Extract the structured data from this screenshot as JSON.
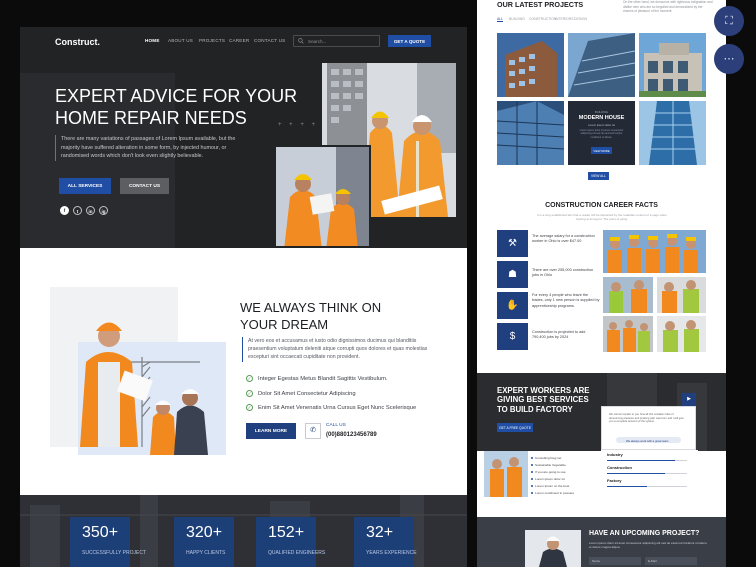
{
  "left": {
    "logo": "Construct.",
    "nav": [
      "HOME",
      "ABOUT US",
      "PROJECTS",
      "CAREER",
      "CONTACT US"
    ],
    "search_placeholder": "Search...",
    "quote_button": "GET A QUOTE",
    "hero_title": "EXPERT ADVICE FOR YOUR HOME REPAIR NEEDS",
    "hero_text": "There are many variations of passages of Lorem Ipsum available, but the majority have suffered alteration in some form, by injected humour, or randomised words which don't look even slightly believable.",
    "hero_buttons": [
      "ALL SERVICES",
      "CONTACT US"
    ],
    "social": [
      "f",
      "t",
      "in",
      "ig"
    ],
    "dream_title": "WE ALWAYS THINK ON YOUR DREAM",
    "dream_text": "At vero eos et accusamus et iusto odio dignissimos ducimus qui blanditiis praesentium voluptatum deleniti atque corrupti quos dolores et quas molestias excepturi sint occaecati cupiditate non provident.",
    "checks": [
      "Integer Egestas Metus Blandit Sagittis Vestibulum.",
      "Dolor Sit Amet Consectetur Adipiscing",
      "Enim Sit Amet Venenatis Urna Cursus Eget Nunc Scelerisque"
    ],
    "learn_more": "LEARN MORE",
    "call_label": "CALL US",
    "phone": "(00)880123456789",
    "stats": [
      {
        "value": "350+",
        "label": "SUCCESSFULLY PROJECT"
      },
      {
        "value": "320+",
        "label": "HAPPY CLIENTS"
      },
      {
        "value": "152+",
        "label": "QUALIFIED ENGINEERS"
      },
      {
        "value": "32+",
        "label": "YEARS EXPERIENCE"
      }
    ]
  },
  "right": {
    "projects_title": "OUR LATEST PROJECTS",
    "projects_sub": "On the other hand, we denounce with righteous indignation and dislike men who are so beguiled and demoralized by the charms of pleasure of the moment.",
    "filters": [
      "ALL",
      "BUILDING",
      "CONSTRUCTION",
      "INTERIORS",
      "DESIGN"
    ],
    "featured_label": "BUILDING",
    "featured_title": "MODERN HOUSE",
    "featured_sub": "Lorem ipsum dolor sit",
    "featured_text": "Lorem ipsum dolor sit amet consectetur adipiscing elit sed do eiusmod tempor incididunt ut labore.",
    "view_more": "VIEW MORE",
    "view_all": "VIEW ALL",
    "facts_title": "CONSTRUCTION CAREER FACTS",
    "facts_sub": "It is a long established fact that a reader will be distracted by the readable content of a page when looking at its layout. The point of using.",
    "facts": [
      "The average salary for a construction worker in Ohio is over $47.00",
      "There are over 255,000 construction jobs in Ohio",
      "For every 4 people who leave the trades, only 1 new person is supplied by apprenticeship programs.",
      "Construction is projected to add 790,400 jobs by 2024"
    ],
    "workers_title": "EXPERT WORKERS ARE GIVING BEST SERVICES TO BUILD FACTORY",
    "workers_button": "GET A FREE QUOTE",
    "workers_card_text": "We cannot explain to you how all this mistaken idea of denouncing pleasure and praising pain was born and I will give you a complete account of the system.",
    "workers_pill": "We always work with a great team",
    "workers_list": [
      "Consulting blog set",
      "Sustainable Vegetable",
      "If you are going to use",
      "Lorem ipsum dolor sit",
      "Lorem Ipsum on the best",
      "Lorem condiment in posuere"
    ],
    "bars": [
      {
        "label": "Industry",
        "value": 0.85
      },
      {
        "label": "Construction",
        "value": 0.72
      },
      {
        "label": "Factory",
        "value": 0.5
      }
    ],
    "upcoming_title": "HAVE AN UPCOMING PROJECT?",
    "upcoming_sub": "Lorem ipsum dolor sit amet consectetur adipiscing elit sed do eiusmod tincidunt ut labore et dolore magna aliqua.",
    "form_fields": [
      "Name",
      "E-Mail"
    ]
  }
}
